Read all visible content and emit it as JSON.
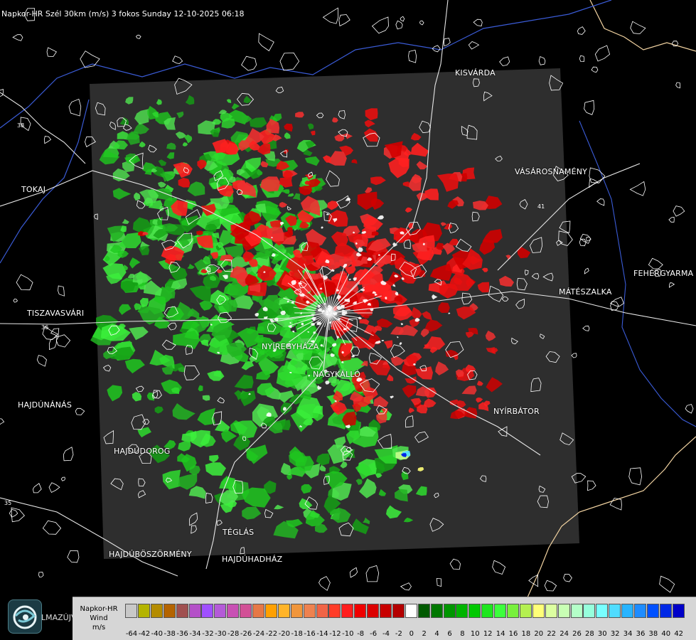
{
  "header": {
    "title": "Napkor-HR Szél 30km (m/s) 3 fokos Sunday 12-10-2025 06:18"
  },
  "map": {
    "radar_domain_fill": "#2e2e2e",
    "background": "#000000",
    "boundary_color": "#ffffff",
    "river_color": "#3a5bd6",
    "border_color": "#f3d4a2",
    "cities": [
      {
        "id": "kisvarda",
        "name": "KISVÁRDA"
      },
      {
        "id": "tokaj",
        "name": "TOKAJ"
      },
      {
        "id": "vasarosnameny",
        "name": "VÁSÁROSNAMÉNY"
      },
      {
        "id": "fehergyarmat",
        "name": "FEHÉRGYARMA"
      },
      {
        "id": "mateszalka",
        "name": "MÁTÉSZALKA"
      },
      {
        "id": "tiszavasvari",
        "name": "TISZAVASVÁRI"
      },
      {
        "id": "nyiregyhaza",
        "name": "NYÍREGYHÁZA"
      },
      {
        "id": "nagykallo",
        "name": "NAGYKÁLLÓ"
      },
      {
        "id": "hajdunanas",
        "name": "HAJDÚNÁNÁS"
      },
      {
        "id": "nyirbator",
        "name": "NYÍRBÁTOR"
      },
      {
        "id": "hajdudorog",
        "name": "HAJDÚDOROG"
      },
      {
        "id": "teglas",
        "name": "TÉGLÁS"
      },
      {
        "id": "hajduboszormeny",
        "name": "HAJDÚBÖSZÖRMÉNY"
      },
      {
        "id": "hajduhadhaz",
        "name": "HAJDÚHADHÁZ"
      }
    ],
    "road_numbers": [
      "38",
      "41",
      "36",
      "35"
    ]
  },
  "legend": {
    "title_line1": "Napkor-HR",
    "title_line2": "Wind",
    "title_line3": "m/s",
    "bins": [
      {
        "value": "-64",
        "color": "#c8c8c8"
      },
      {
        "value": "-42",
        "color": "#b4b400"
      },
      {
        "value": "-40",
        "color": "#b48c00"
      },
      {
        "value": "-38",
        "color": "#b46400"
      },
      {
        "value": "-36",
        "color": "#a05050"
      },
      {
        "value": "-34",
        "color": "#b450c8"
      },
      {
        "value": "-32",
        "color": "#a050ff"
      },
      {
        "value": "-30",
        "color": "#b45ad8"
      },
      {
        "value": "-28",
        "color": "#c850b4"
      },
      {
        "value": "-26",
        "color": "#d25096"
      },
      {
        "value": "-24",
        "color": "#e67846"
      },
      {
        "value": "-22",
        "color": "#ffa000"
      },
      {
        "value": "-20",
        "color": "#ffb428"
      },
      {
        "value": "-18",
        "color": "#f0963c"
      },
      {
        "value": "-16",
        "color": "#ee8250"
      },
      {
        "value": "-14",
        "color": "#f06446"
      },
      {
        "value": "-12",
        "color": "#ff3c28"
      },
      {
        "value": "-10",
        "color": "#ff1e1e"
      },
      {
        "value": "-8",
        "color": "#f00000"
      },
      {
        "value": "-6",
        "color": "#dc0000"
      },
      {
        "value": "-4",
        "color": "#c80000"
      },
      {
        "value": "-2",
        "color": "#b40000"
      },
      {
        "value": "0",
        "color": "#ffffff"
      },
      {
        "value": "2",
        "color": "#005a00"
      },
      {
        "value": "4",
        "color": "#007800"
      },
      {
        "value": "6",
        "color": "#009600"
      },
      {
        "value": "8",
        "color": "#00b400"
      },
      {
        "value": "10",
        "color": "#00c800"
      },
      {
        "value": "12",
        "color": "#1ee61e"
      },
      {
        "value": "14",
        "color": "#3cff3c"
      },
      {
        "value": "16",
        "color": "#78f03c"
      },
      {
        "value": "18",
        "color": "#b4f050"
      },
      {
        "value": "20",
        "color": "#ffff78"
      },
      {
        "value": "22",
        "color": "#dcffa0"
      },
      {
        "value": "24",
        "color": "#c8ffb4"
      },
      {
        "value": "26",
        "color": "#b4ffc8"
      },
      {
        "value": "28",
        "color": "#96ffdc"
      },
      {
        "value": "30",
        "color": "#78ffff"
      },
      {
        "value": "32",
        "color": "#50dcff"
      },
      {
        "value": "34",
        "color": "#28b4ff"
      },
      {
        "value": "36",
        "color": "#1e8cff"
      },
      {
        "value": "38",
        "color": "#0050ff"
      },
      {
        "value": "40",
        "color": "#0028e6"
      },
      {
        "value": "42",
        "color": "#0000c8"
      }
    ]
  },
  "branding": {
    "logo_icon": "swirl-logo-icon",
    "partial_label": "LMAZÚJVÁR"
  }
}
